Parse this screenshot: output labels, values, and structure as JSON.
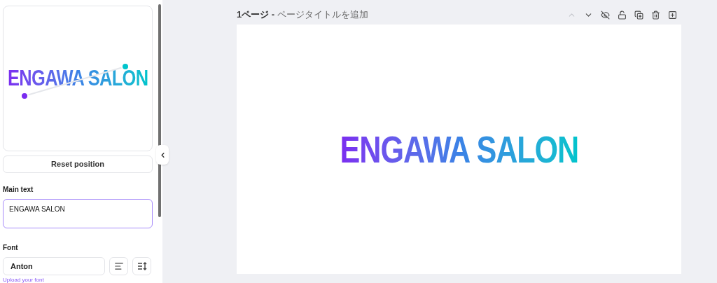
{
  "preview": {
    "text": "ENGAWA SALON"
  },
  "reset_button": "Reset position",
  "main_text": {
    "label": "Main text",
    "value": "ENGAWA SALON"
  },
  "font": {
    "label": "Font",
    "value": "Anton"
  },
  "upload_link": "Upload your font",
  "page": {
    "number": "1ページ -",
    "title_placeholder": "ページタイトルを追加",
    "text": "ENGAWA SALON"
  },
  "toolbar": [
    {
      "kind": "up",
      "disabled": true
    },
    {
      "kind": "down",
      "disabled": false
    },
    {
      "kind": "hide",
      "disabled": false
    },
    {
      "kind": "lock",
      "disabled": false
    },
    {
      "kind": "duplicate",
      "disabled": false
    },
    {
      "kind": "delete",
      "disabled": false
    },
    {
      "kind": "add",
      "disabled": false
    }
  ]
}
